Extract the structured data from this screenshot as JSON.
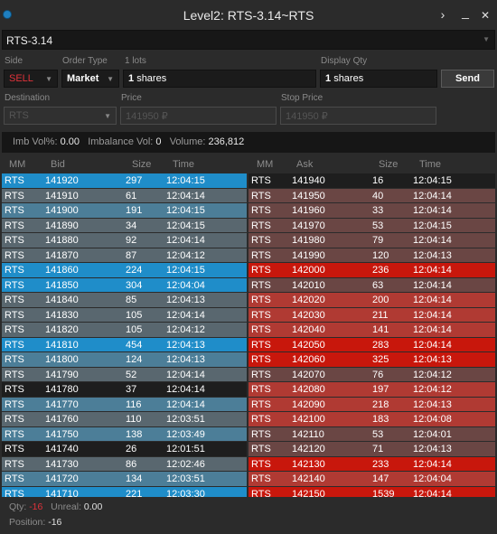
{
  "window": {
    "title": "Level2: RTS-3.14~RTS",
    "more_glyph": "›",
    "min_glyph": "_",
    "close_glyph": "✕"
  },
  "symbol": {
    "value": "RTS-3.14"
  },
  "order": {
    "side_label": "Side",
    "side_value": "SELL",
    "side_color": "#e0323a",
    "order_type_label": "Order Type",
    "order_type_value": "Market",
    "lots_label": "1 lots",
    "qty_number": "1",
    "qty_unit": "shares",
    "display_qty_label": "Display Qty",
    "display_qty_number": "1",
    "display_qty_unit": "shares",
    "send_label": "Send",
    "destination_label": "Destination",
    "destination_value": "RTS",
    "price_label": "Price",
    "price_value": "141950 ₽",
    "stop_price_label": "Stop Price",
    "stop_price_value": "141950 ₽"
  },
  "stats": {
    "imb_vol_label": "Imb Vol%:",
    "imb_vol_value": "0.00",
    "imbalance_vol_label": "Imbalance Vol:",
    "imbalance_vol_value": "0",
    "volume_label": "Volume:",
    "volume_value": "236,812"
  },
  "bid_headers": {
    "mm": "MM",
    "price": "Bid",
    "size": "Size",
    "time": "Time"
  },
  "ask_headers": {
    "mm": "MM",
    "price": "Ask",
    "size": "Size",
    "time": "Time"
  },
  "colors": {
    "bid_bright": "#1f8dc9",
    "bid_mid": "#4c7e98",
    "bid_dim": "#59676f",
    "bid_dark": "#1e1e1e",
    "ask_bright": "#c8170c",
    "ask_mid": "#b03a33",
    "ask_dim": "#6a4644",
    "ask_dark": "#1e1e1e"
  },
  "bids": [
    {
      "mm": "RTS",
      "price": "141920",
      "size": "297",
      "time": "12:04:15",
      "tone": "bright"
    },
    {
      "mm": "RTS",
      "price": "141910",
      "size": "61",
      "time": "12:04:14",
      "tone": "dim"
    },
    {
      "mm": "RTS",
      "price": "141900",
      "size": "191",
      "time": "12:04:15",
      "tone": "mid"
    },
    {
      "mm": "RTS",
      "price": "141890",
      "size": "34",
      "time": "12:04:15",
      "tone": "dim"
    },
    {
      "mm": "RTS",
      "price": "141880",
      "size": "92",
      "time": "12:04:14",
      "tone": "dim"
    },
    {
      "mm": "RTS",
      "price": "141870",
      "size": "87",
      "time": "12:04:12",
      "tone": "dim"
    },
    {
      "mm": "RTS",
      "price": "141860",
      "size": "224",
      "time": "12:04:15",
      "tone": "bright"
    },
    {
      "mm": "RTS",
      "price": "141850",
      "size": "304",
      "time": "12:04:04",
      "tone": "bright"
    },
    {
      "mm": "RTS",
      "price": "141840",
      "size": "85",
      "time": "12:04:13",
      "tone": "dim"
    },
    {
      "mm": "RTS",
      "price": "141830",
      "size": "105",
      "time": "12:04:14",
      "tone": "dim"
    },
    {
      "mm": "RTS",
      "price": "141820",
      "size": "105",
      "time": "12:04:12",
      "tone": "dim"
    },
    {
      "mm": "RTS",
      "price": "141810",
      "size": "454",
      "time": "12:04:13",
      "tone": "bright"
    },
    {
      "mm": "RTS",
      "price": "141800",
      "size": "124",
      "time": "12:04:13",
      "tone": "mid"
    },
    {
      "mm": "RTS",
      "price": "141790",
      "size": "52",
      "time": "12:04:14",
      "tone": "dim"
    },
    {
      "mm": "RTS",
      "price": "141780",
      "size": "37",
      "time": "12:04:14",
      "tone": "dark"
    },
    {
      "mm": "RTS",
      "price": "141770",
      "size": "116",
      "time": "12:04:14",
      "tone": "mid"
    },
    {
      "mm": "RTS",
      "price": "141760",
      "size": "110",
      "time": "12:03:51",
      "tone": "dim"
    },
    {
      "mm": "RTS",
      "price": "141750",
      "size": "138",
      "time": "12:03:49",
      "tone": "mid"
    },
    {
      "mm": "RTS",
      "price": "141740",
      "size": "26",
      "time": "12:01:51",
      "tone": "dark"
    },
    {
      "mm": "RTS",
      "price": "141730",
      "size": "86",
      "time": "12:02:46",
      "tone": "dim"
    },
    {
      "mm": "RTS",
      "price": "141720",
      "size": "134",
      "time": "12:03:51",
      "tone": "mid"
    },
    {
      "mm": "RTS",
      "price": "141710",
      "size": "221",
      "time": "12:03:30",
      "tone": "bright"
    }
  ],
  "asks": [
    {
      "mm": "RTS",
      "price": "141940",
      "size": "16",
      "time": "12:04:15",
      "tone": "dark"
    },
    {
      "mm": "RTS",
      "price": "141950",
      "size": "40",
      "time": "12:04:14",
      "tone": "dim"
    },
    {
      "mm": "RTS",
      "price": "141960",
      "size": "33",
      "time": "12:04:14",
      "tone": "dim"
    },
    {
      "mm": "RTS",
      "price": "141970",
      "size": "53",
      "time": "12:04:15",
      "tone": "dim"
    },
    {
      "mm": "RTS",
      "price": "141980",
      "size": "79",
      "time": "12:04:14",
      "tone": "dim"
    },
    {
      "mm": "RTS",
      "price": "141990",
      "size": "120",
      "time": "12:04:13",
      "tone": "dim"
    },
    {
      "mm": "RTS",
      "price": "142000",
      "size": "236",
      "time": "12:04:14",
      "tone": "bright"
    },
    {
      "mm": "RTS",
      "price": "142010",
      "size": "63",
      "time": "12:04:14",
      "tone": "dim"
    },
    {
      "mm": "RTS",
      "price": "142020",
      "size": "200",
      "time": "12:04:14",
      "tone": "mid"
    },
    {
      "mm": "RTS",
      "price": "142030",
      "size": "211",
      "time": "12:04:14",
      "tone": "mid"
    },
    {
      "mm": "RTS",
      "price": "142040",
      "size": "141",
      "time": "12:04:14",
      "tone": "mid"
    },
    {
      "mm": "RTS",
      "price": "142050",
      "size": "283",
      "time": "12:04:14",
      "tone": "bright"
    },
    {
      "mm": "RTS",
      "price": "142060",
      "size": "325",
      "time": "12:04:13",
      "tone": "bright"
    },
    {
      "mm": "RTS",
      "price": "142070",
      "size": "76",
      "time": "12:04:12",
      "tone": "dim"
    },
    {
      "mm": "RTS",
      "price": "142080",
      "size": "197",
      "time": "12:04:12",
      "tone": "mid"
    },
    {
      "mm": "RTS",
      "price": "142090",
      "size": "218",
      "time": "12:04:13",
      "tone": "mid"
    },
    {
      "mm": "RTS",
      "price": "142100",
      "size": "183",
      "time": "12:04:08",
      "tone": "mid"
    },
    {
      "mm": "RTS",
      "price": "142110",
      "size": "53",
      "time": "12:04:01",
      "tone": "dim"
    },
    {
      "mm": "RTS",
      "price": "142120",
      "size": "71",
      "time": "12:04:13",
      "tone": "dim"
    },
    {
      "mm": "RTS",
      "price": "142130",
      "size": "233",
      "time": "12:04:14",
      "tone": "bright"
    },
    {
      "mm": "RTS",
      "price": "142140",
      "size": "147",
      "time": "12:04:04",
      "tone": "mid"
    },
    {
      "mm": "RTS",
      "price": "142150",
      "size": "1539",
      "time": "12:04:14",
      "tone": "bright"
    }
  ],
  "footer": {
    "qty_label": "Qty:",
    "qty_value": "-16",
    "unreal_label": "Unreal:",
    "unreal_value": "0.00",
    "position_label": "Position:",
    "position_value": "-16"
  }
}
